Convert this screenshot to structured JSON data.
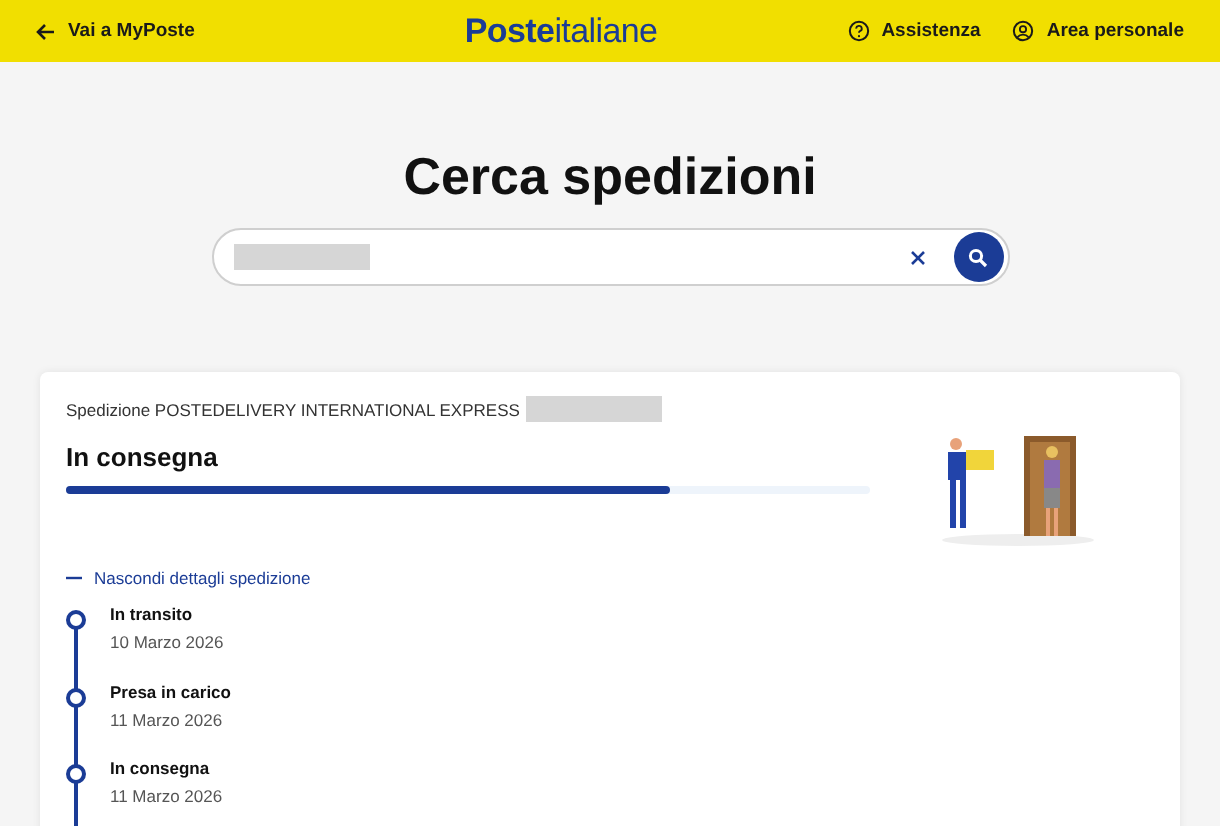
{
  "header": {
    "back_link": "Vai a MyPoste",
    "logo": "**Poste**italiane",
    "links": [
      {
        "kind": "help",
        "label": "Assistenza"
      },
      {
        "kind": "account",
        "label": "Area personale"
      }
    ]
  },
  "title": "Cerca spedizioni",
  "search": {
    "value_redacted": true
  },
  "shipment": {
    "label": "Spedizione POSTEDELIVERY INTERNATIONAL EXPRESS",
    "status": "In consegna",
    "level": 0.75,
    "details_toggle": "Nascondi dettagli spedizione",
    "expanded": true,
    "events": [
      {
        "title": "In transito",
        "date": "10 Marzo 2026"
      },
      {
        "title": "Presa in carico",
        "date": "11 Marzo 2026"
      },
      {
        "title": "In consegna",
        "date": "11 Marzo 2026"
      }
    ]
  }
}
